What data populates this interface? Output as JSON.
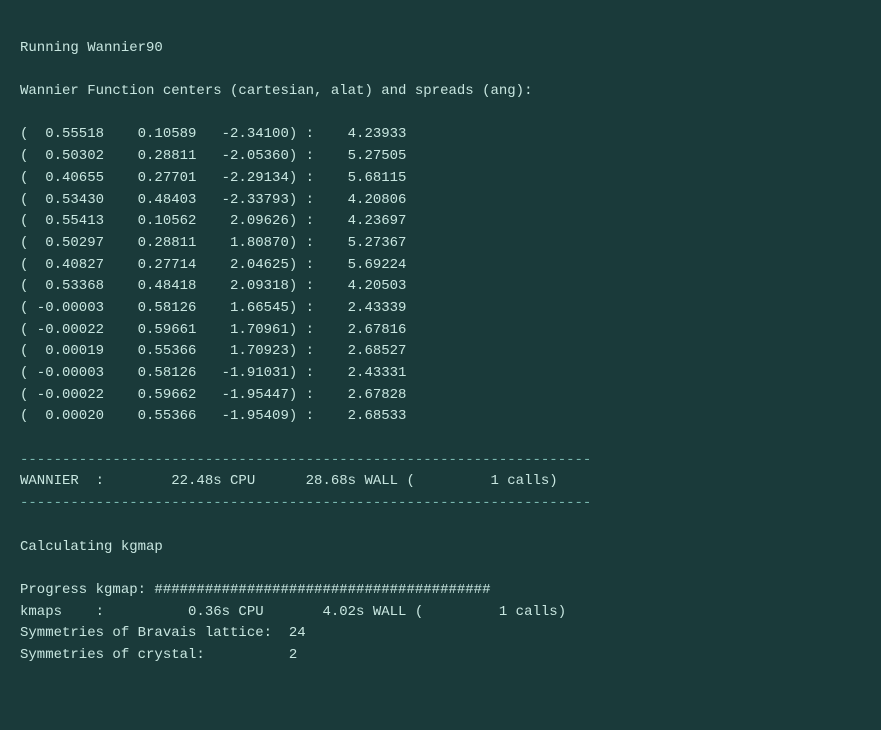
{
  "terminal": {
    "title": "Running Wannier90",
    "header_line": "Wannier Function centers (cartesian, alat) and spreads (ang):",
    "data_rows": [
      {
        "x": "  0.55518",
        "y": "  0.10589",
        "z": " -2.34100",
        "spread": "4.23933"
      },
      {
        "x": "  0.50302",
        "y": "  0.28811",
        "z": " -2.05360",
        "spread": "5.27505"
      },
      {
        "x": "  0.40655",
        "y": "  0.27701",
        "z": " -2.29134",
        "spread": "5.68115"
      },
      {
        "x": "  0.53430",
        "y": "  0.48403",
        "z": " -2.33793",
        "spread": "4.20806"
      },
      {
        "x": "  0.55413",
        "y": "  0.10562",
        "z": "  2.09626",
        "spread": "4.23697"
      },
      {
        "x": "  0.50297",
        "y": "  0.28811",
        "z": "  1.80870",
        "spread": "5.27367"
      },
      {
        "x": "  0.40827",
        "y": "  0.27714",
        "z": "  2.04625",
        "spread": "5.69224"
      },
      {
        "x": "  0.53368",
        "y": "  0.48418",
        "z": "  2.09318",
        "spread": "4.20503"
      },
      {
        "x": " -0.00003",
        "y": "  0.58126",
        "z": "  1.66545",
        "spread": "2.43339"
      },
      {
        "x": " -0.00022",
        "y": "  0.59661",
        "z": "  1.70961",
        "spread": "2.67816"
      },
      {
        "x": "  0.00019",
        "y": "  0.55366",
        "z": "  1.70923",
        "spread": "2.68527"
      },
      {
        "x": " -0.00003",
        "y": "  0.58126",
        "z": " -1.91031",
        "spread": "2.43331"
      },
      {
        "x": " -0.00022",
        "y": "  0.59662",
        "z": " -1.95447",
        "spread": "2.67828"
      },
      {
        "x": "  0.00020",
        "y": "  0.55366",
        "z": " -1.95409",
        "spread": "2.68533"
      }
    ],
    "separator": "--------------------------------------------------------------------",
    "wannier_timing": "WANNIER  :        22.48s CPU      28.68s WALL (         1 calls)",
    "calculating_kgmap": "Calculating kgmap",
    "progress_kgmap_label": "Progress kgmap: ",
    "progress_kgmap_bar": "########################################",
    "kmaps_timing": "kmaps    :          0.36s CPU       4.02s WALL (         1 calls)",
    "symmetries_bravais": "Symmetries of Bravais lattice:  24",
    "symmetries_crystal": "Symmetries of crystal:          2"
  }
}
